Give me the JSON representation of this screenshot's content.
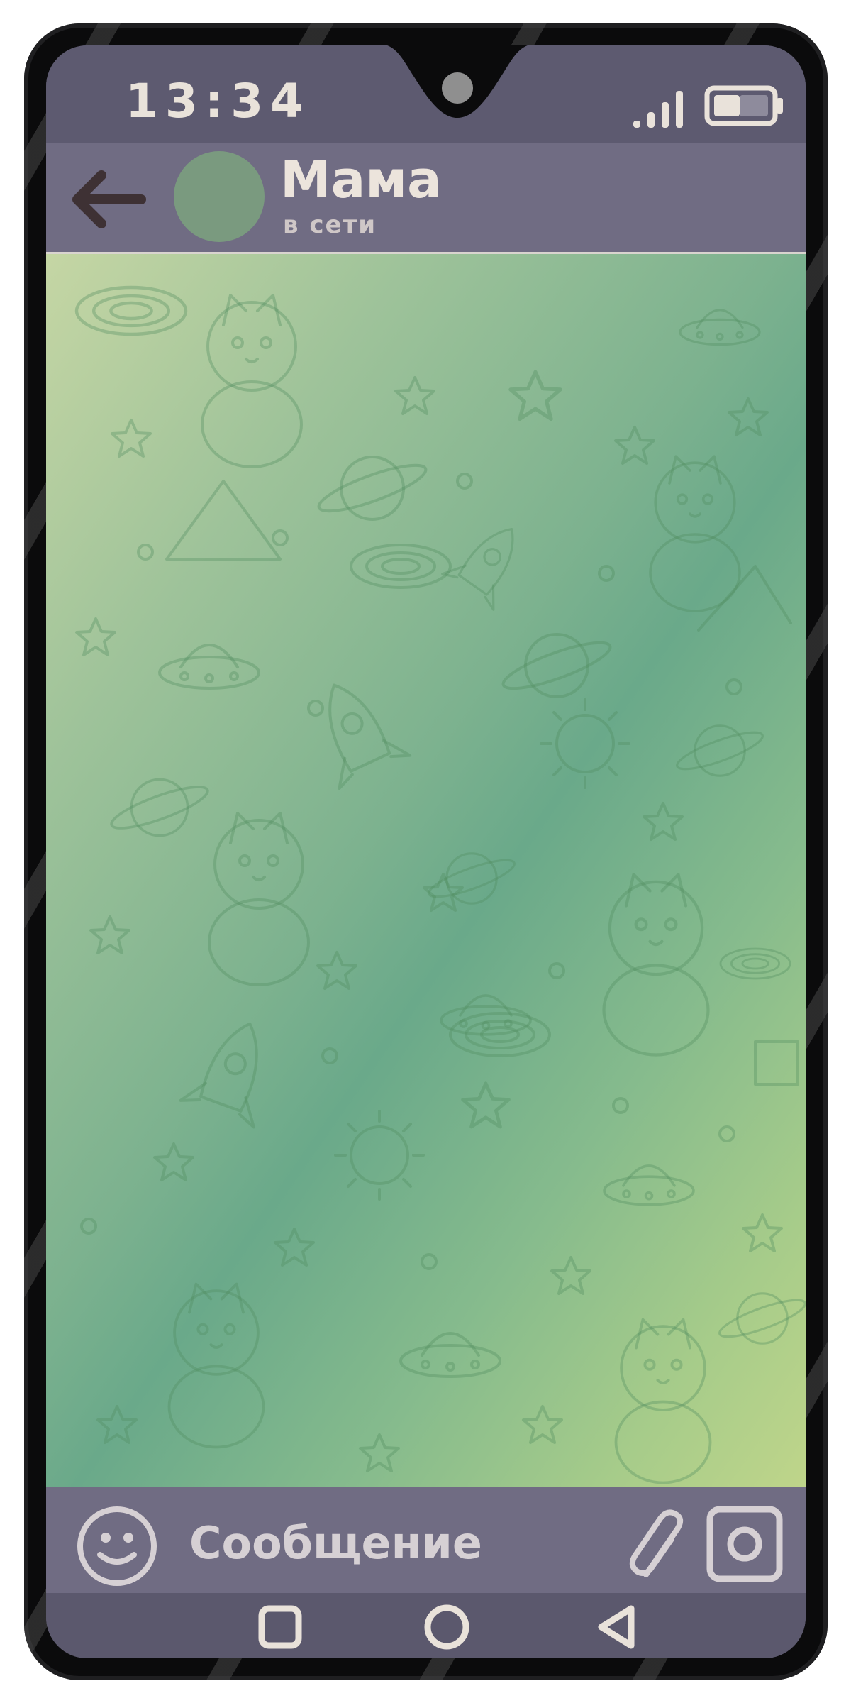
{
  "status_bar": {
    "time": "13:34",
    "icons": [
      "camera-notch-icon",
      "signal-icon",
      "battery-icon"
    ]
  },
  "header": {
    "back_icon": "arrow-left-icon",
    "contact_name": "Мама",
    "contact_status": "в сети"
  },
  "chat": {
    "background": "space-doodles-pattern"
  },
  "input_bar": {
    "placeholder": "Сообщение",
    "icons": [
      "emoji-icon",
      "paperclip-icon",
      "camera-icon"
    ]
  },
  "nav_bar": {
    "icons": [
      "square-icon",
      "circle-icon",
      "triangle-back-icon"
    ]
  },
  "colors": {
    "bar": "#706c83",
    "status_bar": "#5d5a70",
    "icon": "#e9e2da",
    "chat_gradient": [
      "#c5d6a4",
      "#6aa98a",
      "#bfd58a"
    ]
  }
}
